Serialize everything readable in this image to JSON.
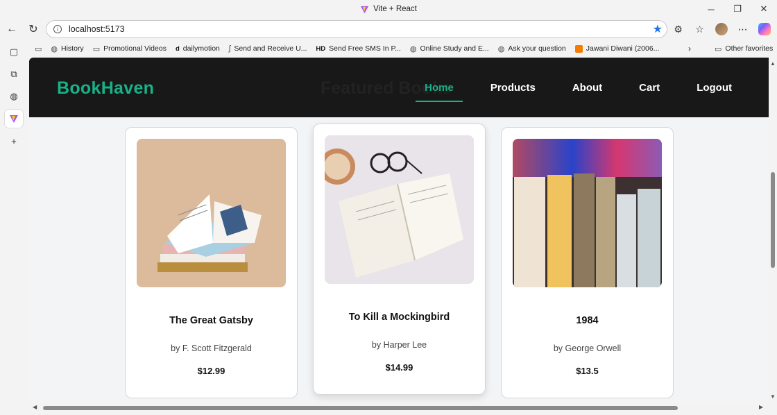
{
  "window": {
    "title": "Vite + React",
    "controls": [
      "minimize",
      "restore",
      "close"
    ]
  },
  "browser": {
    "url": "localhost:5173",
    "bookmarks": [
      {
        "icon": "globe-icon",
        "label": "History"
      },
      {
        "icon": "folder-icon",
        "label": "Promotional Videos"
      },
      {
        "icon": "dailymotion-icon",
        "label": "dailymotion"
      },
      {
        "icon": "sms-icon",
        "label": "Send and Receive U..."
      },
      {
        "icon": "hd-icon",
        "label": "Send Free SMS In P..."
      },
      {
        "icon": "globe-icon",
        "label": "Online Study and E..."
      },
      {
        "icon": "globe-icon",
        "label": "Ask your question"
      },
      {
        "icon": "blogger-icon",
        "label": "Jawani Diwani (2006..."
      }
    ],
    "other_favorites": "Other favorites"
  },
  "site": {
    "brand": "BookHaven",
    "ghost_text": "Featured Books",
    "nav": [
      {
        "label": "Home",
        "active": true
      },
      {
        "label": "Products",
        "active": false
      },
      {
        "label": "About",
        "active": false
      },
      {
        "label": "Cart",
        "active": false
      },
      {
        "label": "Logout",
        "active": false
      }
    ]
  },
  "books": [
    {
      "title": "The Great Gatsby",
      "author": "by F. Scott Fitzgerald",
      "price": "$12.99",
      "image": "stack-of-books"
    },
    {
      "title": "To Kill a Mockingbird",
      "author": "by Harper Lee",
      "price": "$14.99",
      "image": "open-book-coffee-glasses"
    },
    {
      "title": "1984",
      "author": "by George Orwell",
      "price": "$13.5",
      "image": "books-on-shelf"
    }
  ],
  "colors": {
    "accent": "#19b187",
    "header_bg": "#181818",
    "page_bg": "#f3f4f6"
  }
}
